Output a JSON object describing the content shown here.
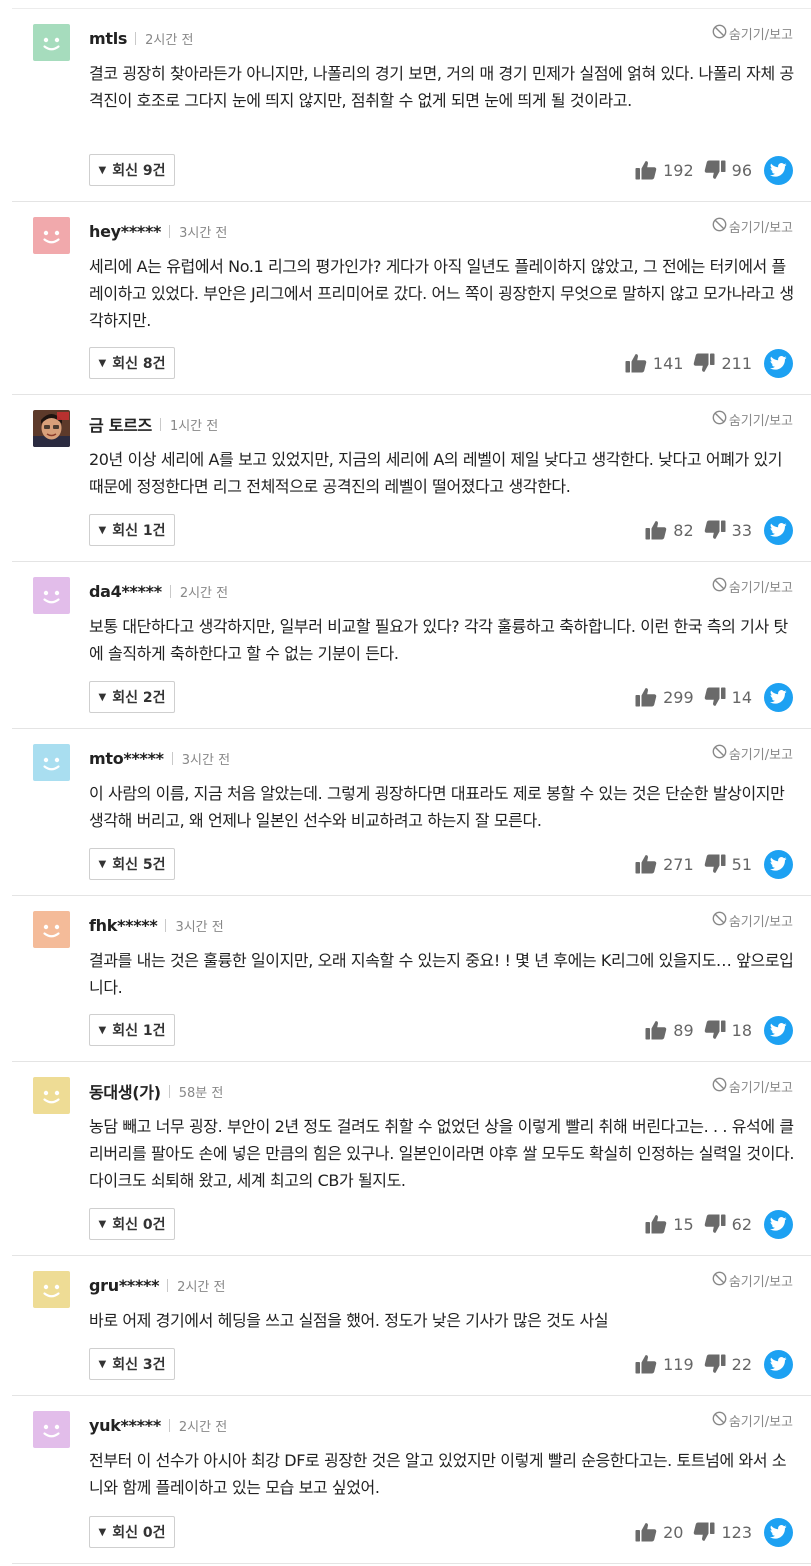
{
  "ui": {
    "hide_report": "숨기기/보고",
    "twitter_icon": "twitter-icon",
    "like_icon": "thumbs-up-icon",
    "dislike_icon": "thumbs-down-icon"
  },
  "comments": [
    {
      "nick": "mtls",
      "time": "2시간 전",
      "avatar": "green-smile",
      "avatar_color": "#a6dcbd",
      "text": "결코 굉장히 찾아라든가 아니지만, 나폴리의 경기 보면, 거의 매 경기 민제가 실점에 얽혀 있다. 나폴리 자체 공격진이 호조로 그다지 눈에 띄지 않지만, 점취할 수 없게 되면 눈에 띄게 될 것이라고.",
      "replies": "회신 9건",
      "likes": "192",
      "dislikes": "96"
    },
    {
      "nick": "hey*****",
      "time": "3시간 전",
      "avatar": "pink-smile",
      "avatar_color": "#f1a9ac",
      "text": "세리에 A는 유럽에서 No.1 리그의 평가인가? 게다가 아직 일년도 플레이하지 않았고, 그 전에는 터키에서 플레이하고 있었다. 부안은 J리그에서 프리미어로 갔다. 어느 쪽이 굉장한지 무엇으로 말하지 않고 모가나라고 생각하지만.",
      "replies": "회신 8건",
      "likes": "141",
      "dislikes": "211"
    },
    {
      "nick": "금 토르즈",
      "time": "1시간 전",
      "avatar": "photo-portrait",
      "avatar_color": "#6b4a3a",
      "text": "20년 이상 세리에 A를 보고 있었지만, 지금의 세리에 A의 레벨이 제일 낮다고 생각한다. 낮다고 어폐가 있기 때문에 정정한다면 리그 전체적으로 공격진의 레벨이 떨어졌다고 생각한다.",
      "replies": "회신 1건",
      "likes": "82",
      "dislikes": "33"
    },
    {
      "nick": "da4*****",
      "time": "2시간 전",
      "avatar": "purple-smile",
      "avatar_color": "#e2bdea",
      "text": "보통 대단하다고 생각하지만, 일부러 비교할 필요가 있다? 각각 훌륭하고 축하합니다. 이런 한국 측의 기사 탓에 솔직하게 축하한다고 할 수 없는 기분이 든다.",
      "replies": "회신 2건",
      "likes": "299",
      "dislikes": "14"
    },
    {
      "nick": "mto*****",
      "time": "3시간 전",
      "avatar": "blue-smile",
      "avatar_color": "#a9def0",
      "text": "이 사람의 이름, 지금 처음 알았는데. 그렇게 굉장하다면 대표라도 제로 봉할 수 있는 것은 단순한 발상이지만 생각해 버리고, 왜 언제나 일본인 선수와 비교하려고 하는지 잘 모른다.",
      "replies": "회신 5건",
      "likes": "271",
      "dislikes": "51"
    },
    {
      "nick": "fhk*****",
      "time": "3시간 전",
      "avatar": "orange-smile",
      "avatar_color": "#f4bb99",
      "text": "결과를 내는 것은 훌륭한 일이지만, 오래 지속할 수 있는지 중요! ! 몇 년 후에는 K리그에 있을지도… 앞으로입니다.",
      "replies": "회신 1건",
      "likes": "89",
      "dislikes": "18"
    },
    {
      "nick": "동대생(가)",
      "time": "58분 전",
      "avatar": "yellow-smile",
      "avatar_color": "#eedc95",
      "text": "농담 빼고 너무 굉장. 부안이 2년 정도 걸려도 취할 수 없었던 상을 이렇게 빨리 취해 버린다고는. . . 유석에 클리버리를 팔아도 손에 넣은 만큼의 힘은 있구나. 일본인이라면 야후 쌀 모두도 확실히 인정하는 실력일 것이다. 다이크도 쇠퇴해 왔고, 세계 최고의 CB가 될지도.",
      "replies": "회신 0건",
      "likes": "15",
      "dislikes": "62"
    },
    {
      "nick": "gru*****",
      "time": "2시간 전",
      "avatar": "yellow-smile",
      "avatar_color": "#eedc95",
      "text": "바로 어제 경기에서 헤딩을 쓰고 실점을 했어. 정도가 낮은 기사가 많은 것도 사실",
      "replies": "회신 3건",
      "likes": "119",
      "dislikes": "22"
    },
    {
      "nick": "yuk*****",
      "time": "2시간 전",
      "avatar": "purple-smile",
      "avatar_color": "#e2bdea",
      "text": "전부터 이 선수가 아시아 최강 DF로 굉장한 것은 알고 있었지만 이렇게 빨리 순응한다고는. 토트넘에 와서 소니와 함께 플레이하고 있는 모습 보고 싶었어.",
      "replies": "회신 0건",
      "likes": "20",
      "dislikes": "123"
    }
  ]
}
